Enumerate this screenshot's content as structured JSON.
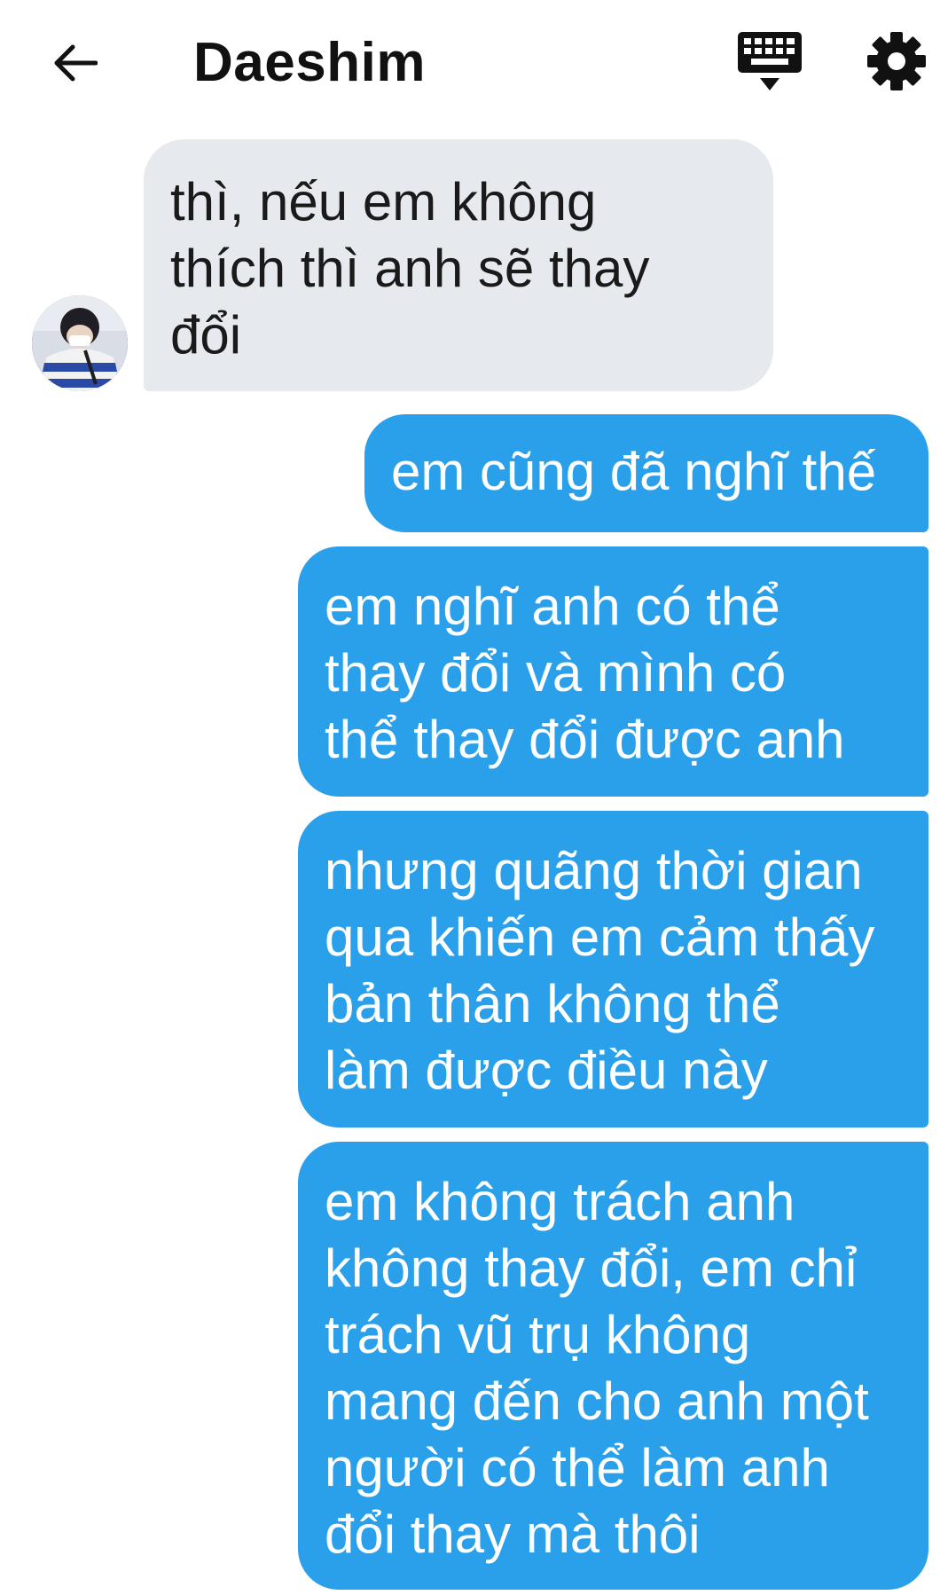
{
  "header": {
    "title": "Daeshim",
    "back_icon": "arrow-left-icon",
    "keyboard_icon": "keyboard-icon",
    "settings_icon": "gear-icon"
  },
  "colors": {
    "sent_bubble": "#2aa0eb",
    "received_bubble": "#e6e9ee",
    "text_dark": "#111111",
    "text_light": "#ffffff"
  },
  "messages": [
    {
      "direction": "received",
      "text": "thì, nếu em không\nthích thì anh sẽ thay\nđổi"
    },
    {
      "direction": "sent",
      "text": "em cũng đã nghĩ thế"
    },
    {
      "direction": "sent",
      "text": "em nghĩ anh có thể\nthay đổi và mình có\nthể thay đổi được anh"
    },
    {
      "direction": "sent",
      "text": "nhưng quãng thời gian\nqua khiến em cảm thấy\nbản thân không thể\nlàm được điều này"
    },
    {
      "direction": "sent",
      "text": "em không trách anh\nkhông thay đổi, em chỉ\ntrách vũ trụ không\nmang đến cho anh một\nngười có thể làm anh\nđổi thay mà thôi"
    }
  ]
}
